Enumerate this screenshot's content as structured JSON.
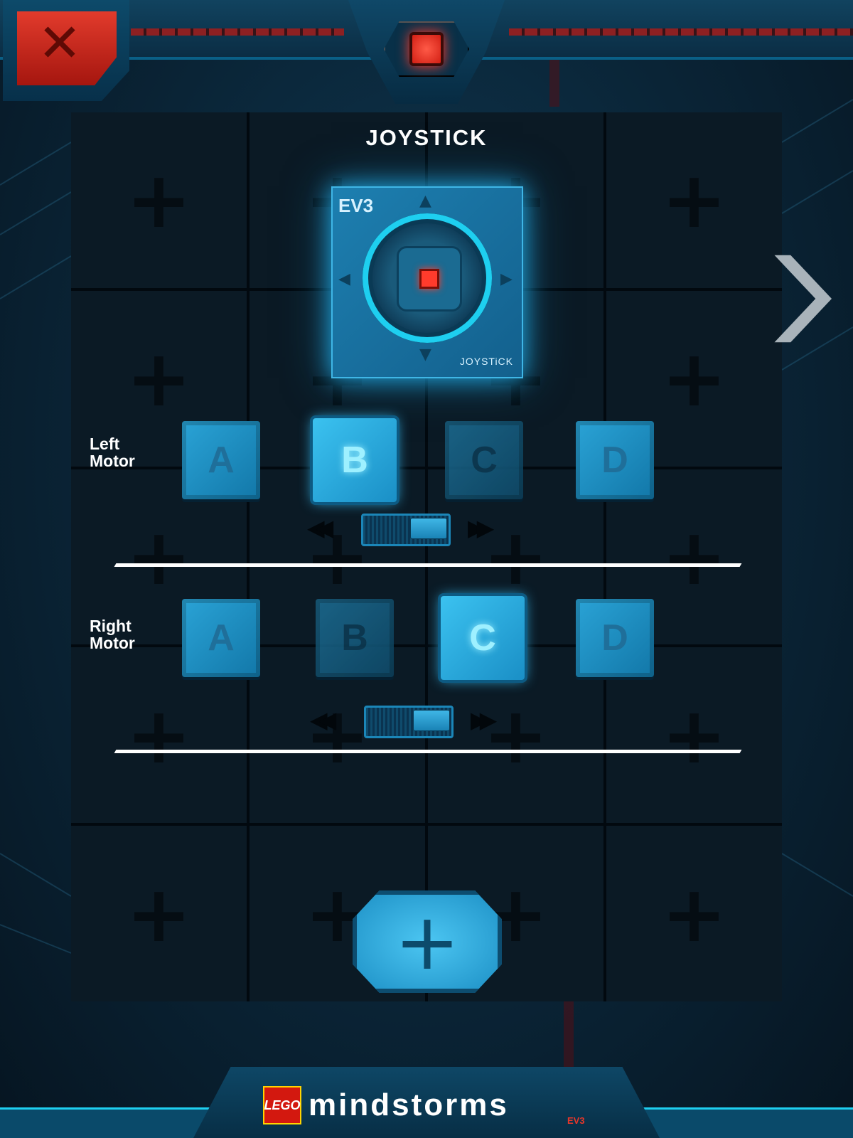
{
  "widget": {
    "title": "JOYSTICK",
    "brand_tag": "EV3",
    "label": "JOYSTiCK"
  },
  "left_motor": {
    "label_line1": "Left",
    "label_line2": "Motor",
    "ports": [
      {
        "label": "A",
        "state": "available"
      },
      {
        "label": "B",
        "state": "selected"
      },
      {
        "label": "C",
        "state": "inactive"
      },
      {
        "label": "D",
        "state": "available"
      }
    ],
    "direction": "forward"
  },
  "right_motor": {
    "label_line1": "Right",
    "label_line2": "Motor",
    "ports": [
      {
        "label": "A",
        "state": "available"
      },
      {
        "label": "B",
        "state": "inactive"
      },
      {
        "label": "C",
        "state": "selected"
      },
      {
        "label": "D",
        "state": "available"
      }
    ],
    "direction": "forward"
  },
  "footer": {
    "lego": "LEGO",
    "brand": "mindstorms",
    "edition": "EV3"
  },
  "colors": {
    "accent": "#1ecff0",
    "stop": "#ff3b2c",
    "port_active": "#3bc2f0"
  }
}
